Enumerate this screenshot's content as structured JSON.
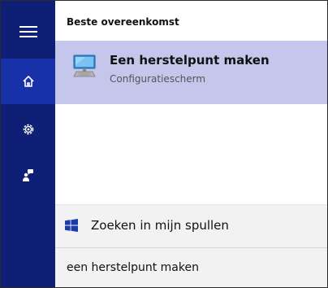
{
  "rail": {
    "items": [
      {
        "icon": "hamburger-menu-icon",
        "active": false
      },
      {
        "icon": "home-icon",
        "active": true
      },
      {
        "icon": "gear-icon",
        "active": false
      },
      {
        "icon": "feedback-person-icon",
        "active": false
      }
    ]
  },
  "results": {
    "section_header": "Beste overeenkomst",
    "best_match": {
      "title": "Een herstelpunt maken",
      "subtitle": "Configuratiescherm",
      "icon": "computer-system-icon"
    }
  },
  "my_stuff": {
    "label": "Zoeken in mijn spullen",
    "icon": "windows-logo-icon"
  },
  "search": {
    "value": "een herstelpunt maken"
  },
  "colors": {
    "rail_background": "#0f1f75",
    "rail_active": "#1830a8",
    "selected_result": "#c4c6ec",
    "windows_logo": "#1c3aa8"
  }
}
